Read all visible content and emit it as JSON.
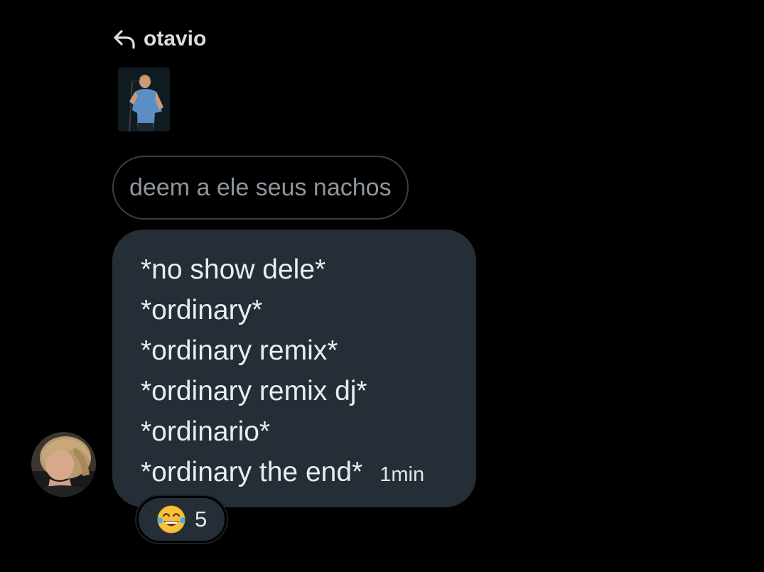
{
  "reply": {
    "icon": "reply-arrow-icon",
    "name": "otavio"
  },
  "thumbnail": {
    "description_icon": "concert-photo-thumbnail"
  },
  "quoted_message": {
    "text": "deem a ele seus nachos"
  },
  "message": {
    "lines": [
      "*no show dele*",
      "*ordinary*",
      "*ordinary remix*",
      "*ordinary remix dj*",
      "*ordinario*",
      "*ordinary the end*"
    ],
    "timestamp": "1min"
  },
  "sender": {
    "avatar_icon": "user-avatar"
  },
  "reaction": {
    "emoji_icon": "face-with-tears-of-joy-icon",
    "count": "5"
  },
  "colors": {
    "background": "#000000",
    "bubble": "#252e36",
    "pill_border": "#3a3f44",
    "muted_text": "#8e969d"
  }
}
